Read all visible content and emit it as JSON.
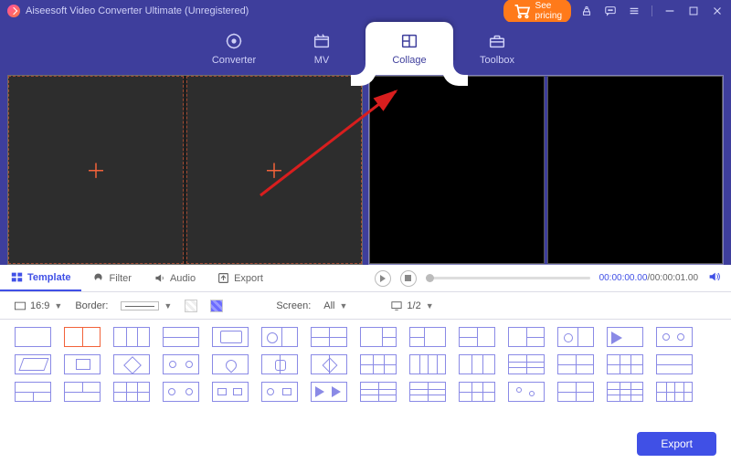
{
  "title": "Aiseesoft Video Converter Ultimate (Unregistered)",
  "see_pricing": "See pricing",
  "tabs": {
    "converter": "Converter",
    "mv": "MV",
    "collage": "Collage",
    "toolbox": "Toolbox"
  },
  "subtabs": {
    "template": "Template",
    "filter": "Filter",
    "audio": "Audio",
    "export": "Export"
  },
  "playback": {
    "current": "00:00:00.00",
    "total": "00:00:01.00"
  },
  "options": {
    "ratio": "16:9",
    "border_label": "Border:",
    "screen_label": "Screen:",
    "screen_value": "All",
    "pager": "1/2"
  },
  "export_button": "Export",
  "colors": {
    "accent": "#4050e6",
    "orange": "#ff7a1a",
    "purple": "#3e3e9c"
  }
}
